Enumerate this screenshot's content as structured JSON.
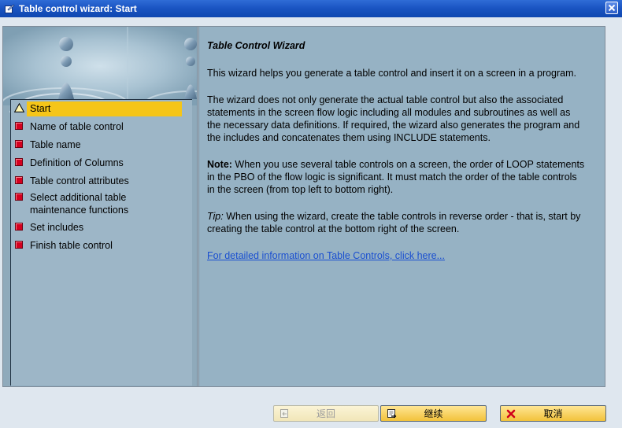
{
  "window": {
    "title": "Table control wizard: Start"
  },
  "steps": [
    {
      "label": "Start",
      "icon": "warning-triangle-icon",
      "active": true
    },
    {
      "label": "Name of table control",
      "icon": "red-square-icon"
    },
    {
      "label": "Table name",
      "icon": "red-square-icon"
    },
    {
      "label": "Definition of Columns",
      "icon": "red-square-icon"
    },
    {
      "label": "Table control attributes",
      "icon": "red-square-icon"
    },
    {
      "label": "Select additional table maintenance functions",
      "icon": "red-square-icon"
    },
    {
      "label": "Set includes",
      "icon": "red-square-icon"
    },
    {
      "label": "Finish table control",
      "icon": "red-square-icon"
    }
  ],
  "content": {
    "heading": "Table Control Wizard",
    "para1": "This wizard helps you generate a table control and insert it on a screen in a program.",
    "para2": "The wizard does not only generate the actual table control but also the associated statements in the screen flow logic including all modules and subroutines as well as the necessary data definitions. If required, the wizard also generates the program and the includes and concatenates them using INCLUDE statements.",
    "note_label": "Note:",
    "note_text": " When you use several table controls on a screen, the order of LOOP statements in the PBO of the flow logic is significant. It must match the order of the table controls in the screen (from top left to bottom right).",
    "tip_label": "Tip:",
    "tip_text": " When using the wizard, create the table controls in reverse order - that is, start by creating the table control at the bottom right of the screen.",
    "link_text": "For detailed information on Table Controls, click here..."
  },
  "buttons": {
    "back": "返回",
    "continue": "继续",
    "cancel": "取消"
  },
  "colors": {
    "titlebar": "#1b55c3",
    "active_step": "#f5c518",
    "panel": "#96b2c4",
    "button": "#f2c23b",
    "link": "#1a4fd0"
  }
}
